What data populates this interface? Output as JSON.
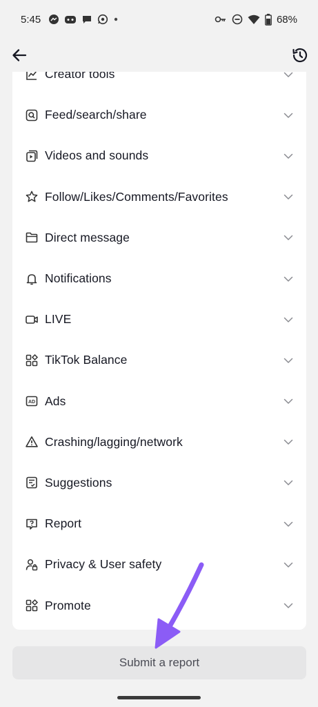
{
  "status_bar": {
    "time": "5:45",
    "battery": "68%",
    "icons_left": [
      "messenger-icon",
      "discord-icon",
      "chat-icon",
      "whatsapp-icon",
      "dot-icon"
    ],
    "icons_right": [
      "key-icon",
      "dnd-icon",
      "wifi-icon",
      "battery-icon"
    ]
  },
  "header": {
    "back_icon": "arrow-left-icon",
    "history_icon": "history-icon"
  },
  "categories": [
    {
      "label": "Creator tools",
      "icon": "chart-icon"
    },
    {
      "label": "Feed/search/share",
      "icon": "search-box-icon"
    },
    {
      "label": "Videos and sounds",
      "icon": "video-stack-icon"
    },
    {
      "label": "Follow/Likes/Comments/Favorites",
      "icon": "star-icon"
    },
    {
      "label": "Direct message",
      "icon": "folder-icon"
    },
    {
      "label": "Notifications",
      "icon": "bell-icon"
    },
    {
      "label": "LIVE",
      "icon": "camera-icon"
    },
    {
      "label": "TikTok Balance",
      "icon": "grid-icon"
    },
    {
      "label": "Ads",
      "icon": "ad-icon"
    },
    {
      "label": "Crashing/lagging/network",
      "icon": "warning-icon"
    },
    {
      "label": "Suggestions",
      "icon": "checklist-icon"
    },
    {
      "label": "Report",
      "icon": "report-icon"
    },
    {
      "label": "Privacy & User safety",
      "icon": "user-lock-icon"
    },
    {
      "label": "Promote",
      "icon": "grid-icon"
    }
  ],
  "submit_label": "Submit a report",
  "colors": {
    "background": "#f2f2f2",
    "card": "#ffffff",
    "button": "#e6e6e7",
    "arrow": "#8b5cf6",
    "text": "#161823"
  }
}
